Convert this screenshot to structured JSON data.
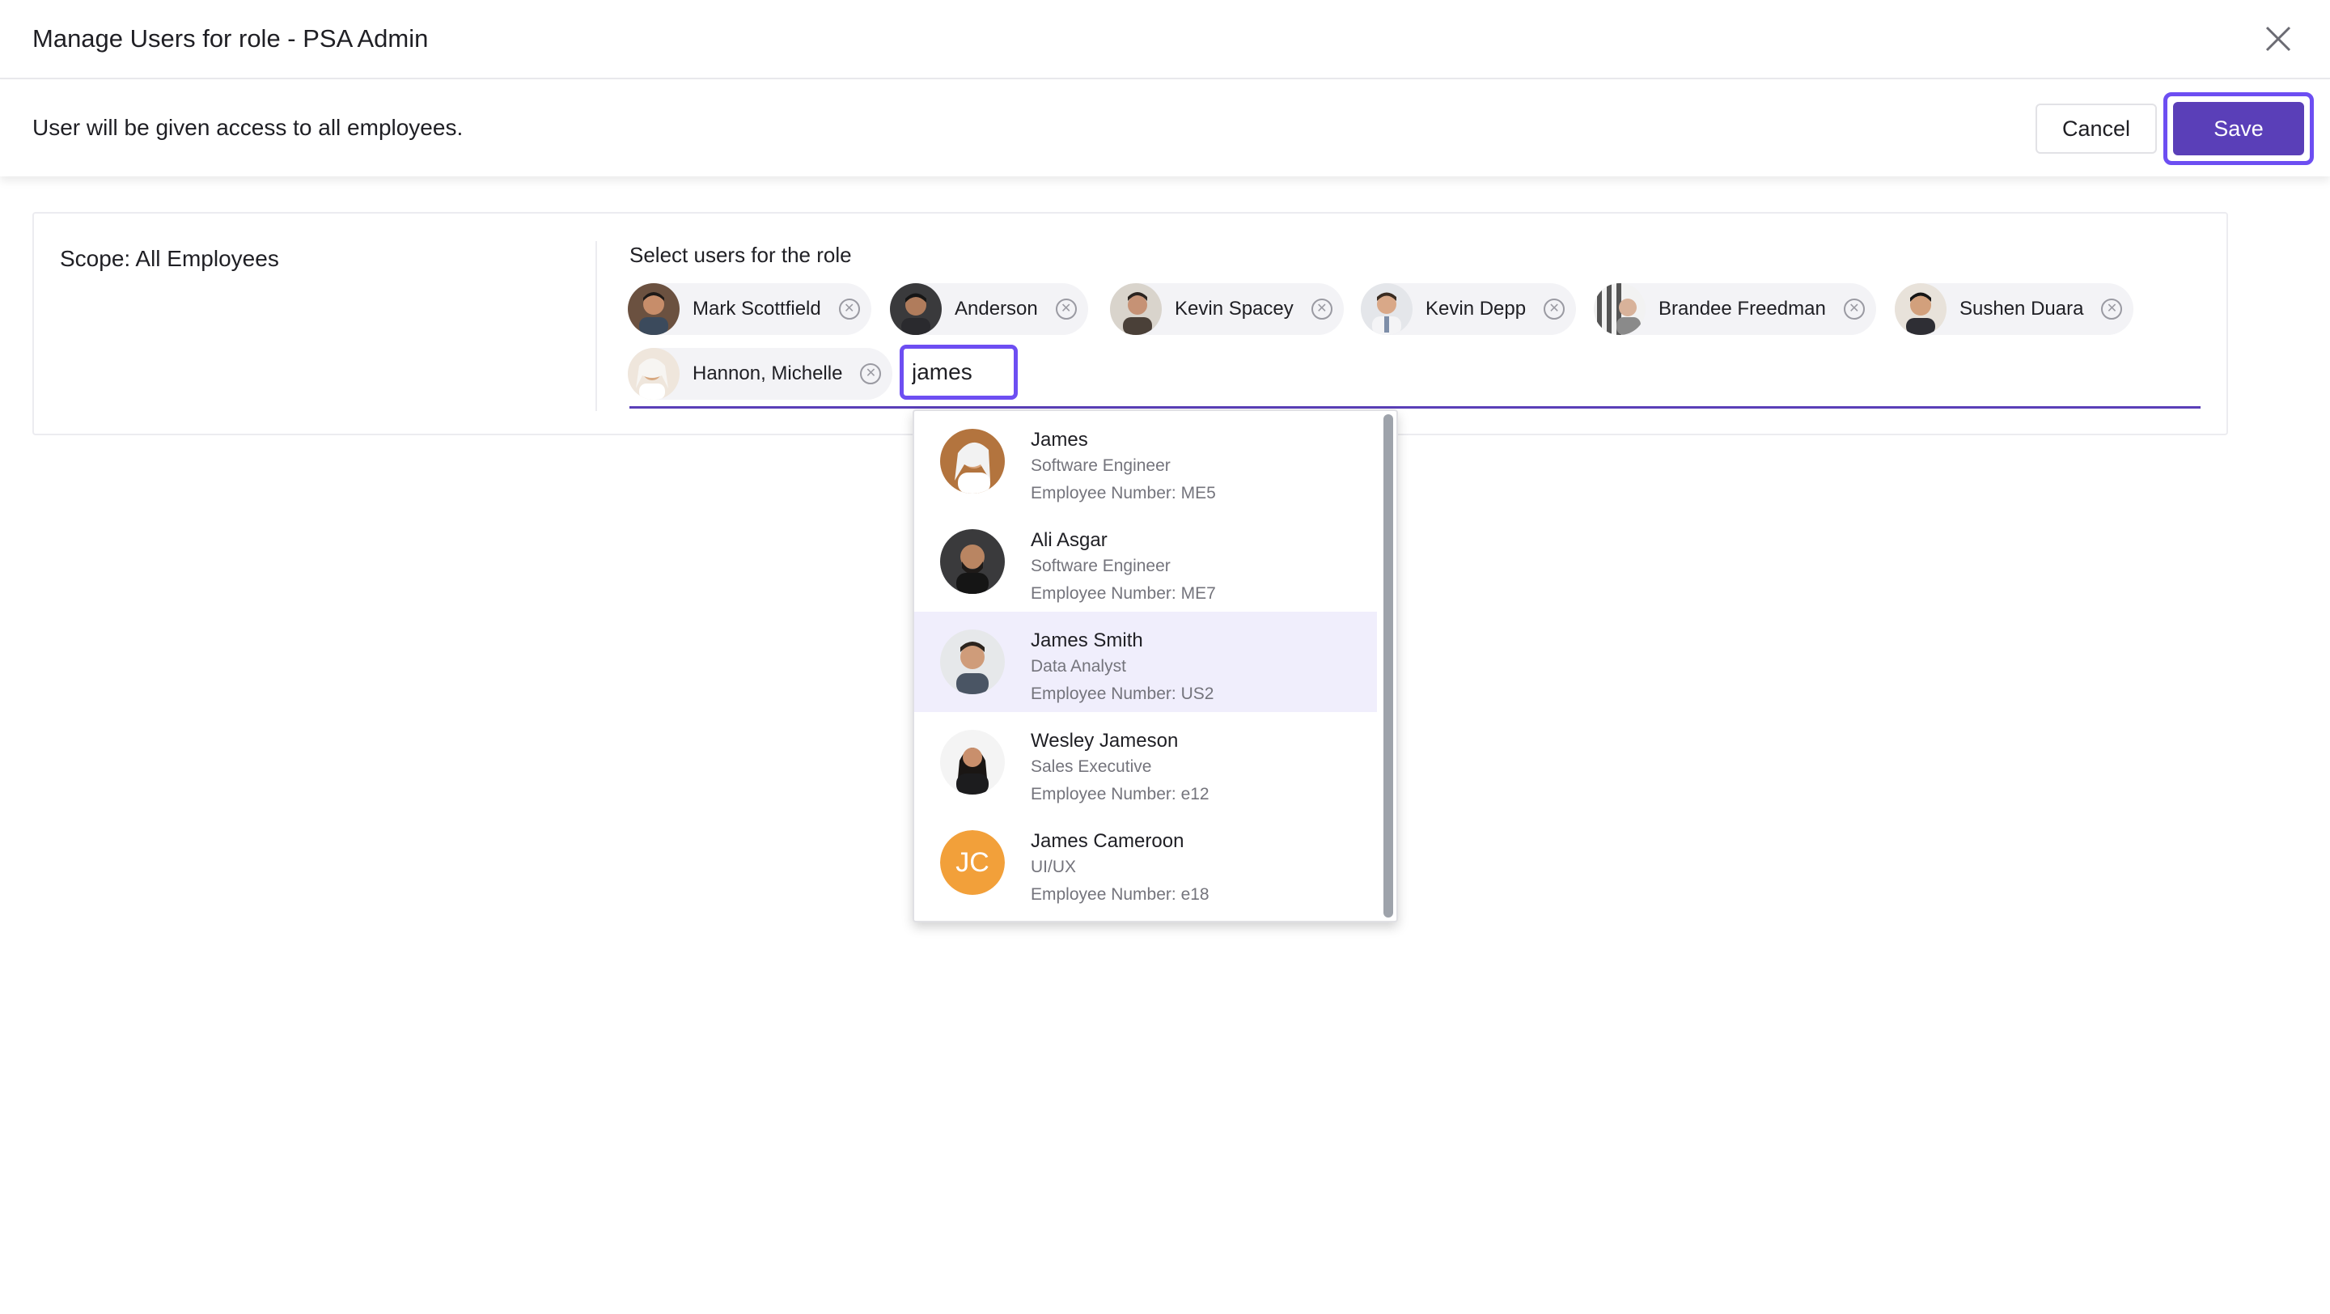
{
  "header": {
    "title": "Manage Users for role - PSA Admin",
    "close_icon": "close-icon"
  },
  "subheader": {
    "message": "User will be given access to all employees.",
    "cancel_label": "Cancel",
    "save_label": "Save"
  },
  "scope": {
    "label": "Scope: All Employees"
  },
  "selector": {
    "label": "Select users for the role",
    "query": "james",
    "selected": [
      {
        "name": "Mark Scottfield"
      },
      {
        "name": "Anderson"
      },
      {
        "name": "Kevin Spacey"
      },
      {
        "name": "Kevin Depp"
      },
      {
        "name": "Brandee Freedman"
      },
      {
        "name": "Sushen Duara"
      },
      {
        "name": "Hannon, Michelle"
      }
    ]
  },
  "results": [
    {
      "name": "James",
      "role": "Software Engineer",
      "employee_number": "Employee Number: ME5"
    },
    {
      "name": "Ali Asgar",
      "role": "Software Engineer",
      "employee_number": "Employee Number: ME7"
    },
    {
      "name": "James Smith",
      "role": "Data Analyst",
      "employee_number": "Employee Number: US2",
      "highlighted": true
    },
    {
      "name": "Wesley Jameson",
      "role": "Sales Executive",
      "employee_number": "Employee Number: e12"
    },
    {
      "name": "James Cameroon",
      "role": "UI/UX",
      "employee_number": "Employee Number: e18",
      "initials": "JC"
    }
  ],
  "colors": {
    "accent": "#5a3fb8",
    "focus_ring": "#6d4ef2",
    "highlight_row": "#f0eefc",
    "initials_avatar": "#f2a03a"
  }
}
